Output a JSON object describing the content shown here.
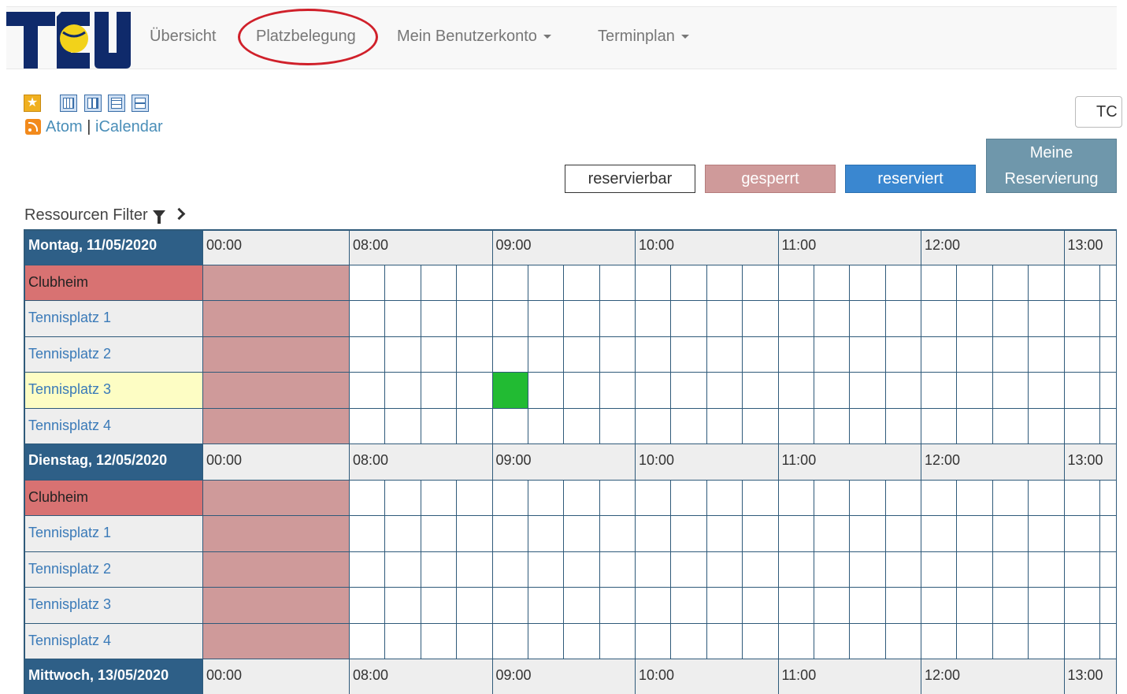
{
  "nav": {
    "items": [
      {
        "label": "Übersicht",
        "dropdown": false
      },
      {
        "label": "Platzbelegung",
        "dropdown": false,
        "highlighted": true
      },
      {
        "label": "Mein Benutzerkonto",
        "dropdown": true
      },
      {
        "label": "Terminplan",
        "dropdown": true
      }
    ],
    "highlight_color": "#d0202a"
  },
  "toolbar": {
    "icons": [
      "favorite-star-icon",
      "view-day-icon",
      "view-week-icon",
      "view-list-icon",
      "view-compact-icon"
    ],
    "feed_atom": "Atom",
    "feed_separator": "|",
    "feed_ical": "iCalendar",
    "club_selector_label": "TC"
  },
  "legend": {
    "reservierbar": "reservierbar",
    "gesperrt": "gesperrt",
    "reserviert": "reserviert",
    "meine_line1": "Meine",
    "meine_line2": "Reservierung",
    "colors": {
      "reservierbar": "#ffffff",
      "gesperrt": "#cf9a9a",
      "reserviert": "#3a87d0",
      "meine": "#6f97ab",
      "own_booking": "#22bb33"
    }
  },
  "filter": {
    "label": "Ressourcen Filter"
  },
  "schedule": {
    "time_labels": [
      "00:00",
      "08:00",
      "09:00",
      "10:00",
      "11:00",
      "12:00",
      "13:00"
    ],
    "slots_per_hour": 4,
    "days": [
      {
        "label": "Montag, 11/05/2020",
        "resources": [
          {
            "name": "Clubheim",
            "type": "club"
          },
          {
            "name": "Tennisplatz 1",
            "type": "court"
          },
          {
            "name": "Tennisplatz 2",
            "type": "court"
          },
          {
            "name": "Tennisplatz 3",
            "type": "court",
            "selected": true,
            "booking": {
              "start": "09:00",
              "end": "09:15"
            }
          },
          {
            "name": "Tennisplatz 4",
            "type": "court"
          }
        ]
      },
      {
        "label": "Dienstag, 12/05/2020",
        "resources": [
          {
            "name": "Clubheim",
            "type": "club"
          },
          {
            "name": "Tennisplatz 1",
            "type": "court"
          },
          {
            "name": "Tennisplatz 2",
            "type": "court"
          },
          {
            "name": "Tennisplatz 3",
            "type": "court"
          },
          {
            "name": "Tennisplatz 4",
            "type": "court"
          }
        ]
      },
      {
        "label": "Mittwoch, 13/05/2020",
        "resources": []
      }
    ]
  }
}
